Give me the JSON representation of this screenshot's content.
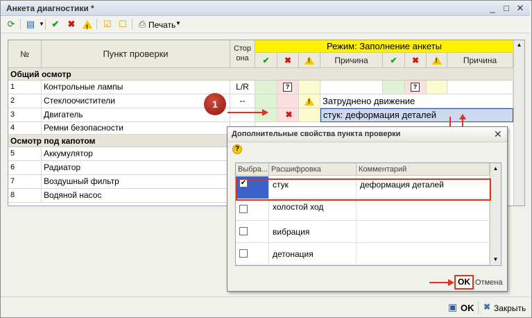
{
  "window": {
    "title": "Анкета диагностики *"
  },
  "toolbar": {
    "print_label": "Печать"
  },
  "table": {
    "col_no": "№",
    "col_item": "Пункт проверки",
    "col_side": "Стор\nона",
    "mode_header": "Режим: Заполнение анкеты",
    "reason1": "Причина",
    "reason2": "Причина",
    "groups": [
      {
        "title": "Общий осмотр"
      },
      {
        "title": "Осмотр под капотом"
      }
    ],
    "rows": [
      {
        "no": "1",
        "item": "Контрольные лампы",
        "side": "L/R",
        "reason": ""
      },
      {
        "no": "2",
        "item": "Стеклоочистители",
        "side": "--",
        "reason": "Затруднено движение"
      },
      {
        "no": "3",
        "item": "Двигатель",
        "side": "",
        "reason": "стук: деформация деталей"
      },
      {
        "no": "4",
        "item": "Ремни безопасности",
        "side": "",
        "reason": ""
      },
      {
        "no": "5",
        "item": "Аккумулятор"
      },
      {
        "no": "6",
        "item": "Радиатор"
      },
      {
        "no": "7",
        "item": "Воздушный фильтр"
      },
      {
        "no": "8",
        "item": "Водяной насос"
      }
    ]
  },
  "callout": "1",
  "dialog": {
    "title": "Дополнительные свойства пункта проверки",
    "col_selected": "Выбра...",
    "col_decode": "Расшифровка",
    "col_comment": "Комментарий",
    "items": [
      {
        "checked": true,
        "decode": "стук",
        "comment": "деформация деталей"
      },
      {
        "checked": false,
        "decode": "холостой ход",
        "comment": ""
      },
      {
        "checked": false,
        "decode": "вибрация",
        "comment": ""
      },
      {
        "checked": false,
        "decode": "детонация",
        "comment": ""
      }
    ],
    "ok": "OK",
    "cancel": "Отмена"
  },
  "footer": {
    "ok": "OK",
    "close": "Закрыть"
  },
  "colors": {
    "accent_red": "#e0321c",
    "mode_yellow": "#fff200",
    "callout": "#a4201a"
  }
}
